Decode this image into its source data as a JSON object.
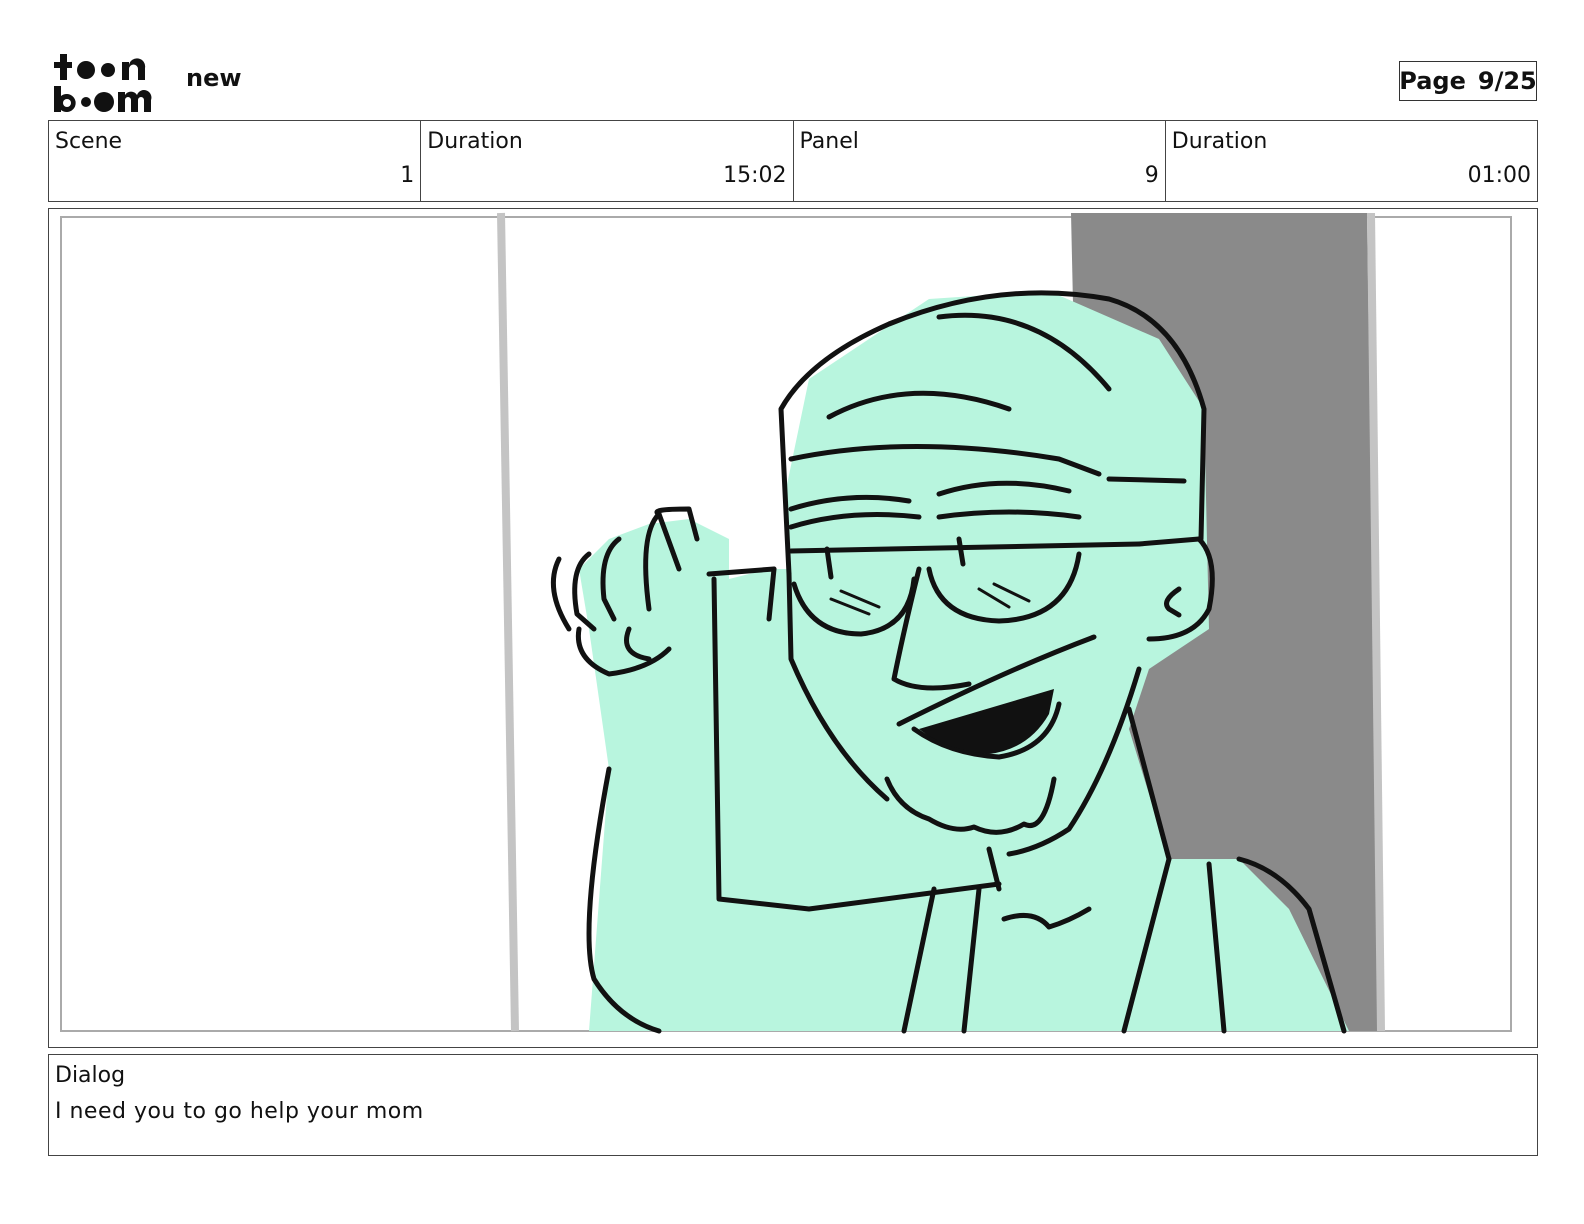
{
  "header": {
    "logo_text": "toonboom",
    "project_title": "new",
    "page_label": "Page",
    "page_number": "9/25"
  },
  "info": {
    "scene_label": "Scene",
    "scene_value": "1",
    "scene_duration_label": "Duration",
    "scene_duration_value": "15:02",
    "panel_label": "Panel",
    "panel_value": "9",
    "panel_duration_label": "Duration",
    "panel_duration_value": "01:00"
  },
  "panel_image": {
    "icon": "storyboard-drawing-icon",
    "fill_color": "#b8f5de",
    "background_wall_color": "#8a8a8a"
  },
  "dialog": {
    "label": "Dialog",
    "text": "I need you to go help your mom"
  }
}
